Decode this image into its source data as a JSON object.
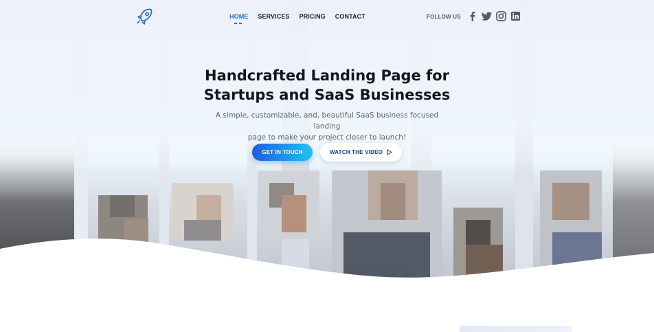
{
  "nav": {
    "items": [
      {
        "label": "HOME",
        "active": true
      },
      {
        "label": "SERVICES",
        "active": false
      },
      {
        "label": "PRICING",
        "active": false
      },
      {
        "label": "CONTACT",
        "active": false
      }
    ]
  },
  "social": {
    "label": "FOLLOW US",
    "icons": [
      "facebook-icon",
      "twitter-icon",
      "instagram-icon",
      "linkedin-icon"
    ]
  },
  "hero": {
    "headline_line1": "Handcrafted Landing Page for",
    "headline_line2": "Startups and SaaS Businesses",
    "subtext_line1": "A simple, customizable, and, beautiful SaaS business focused landing",
    "subtext_line2": "page to make your project closer to launch!",
    "primary_cta": "GET IN TOUCH",
    "secondary_cta": "WATCH THE VIDEO"
  },
  "colors": {
    "accent": "#1e6fd9",
    "gradient_start": "#1a5fe0",
    "gradient_end": "#22c1ef",
    "text_dark": "#14161c"
  }
}
